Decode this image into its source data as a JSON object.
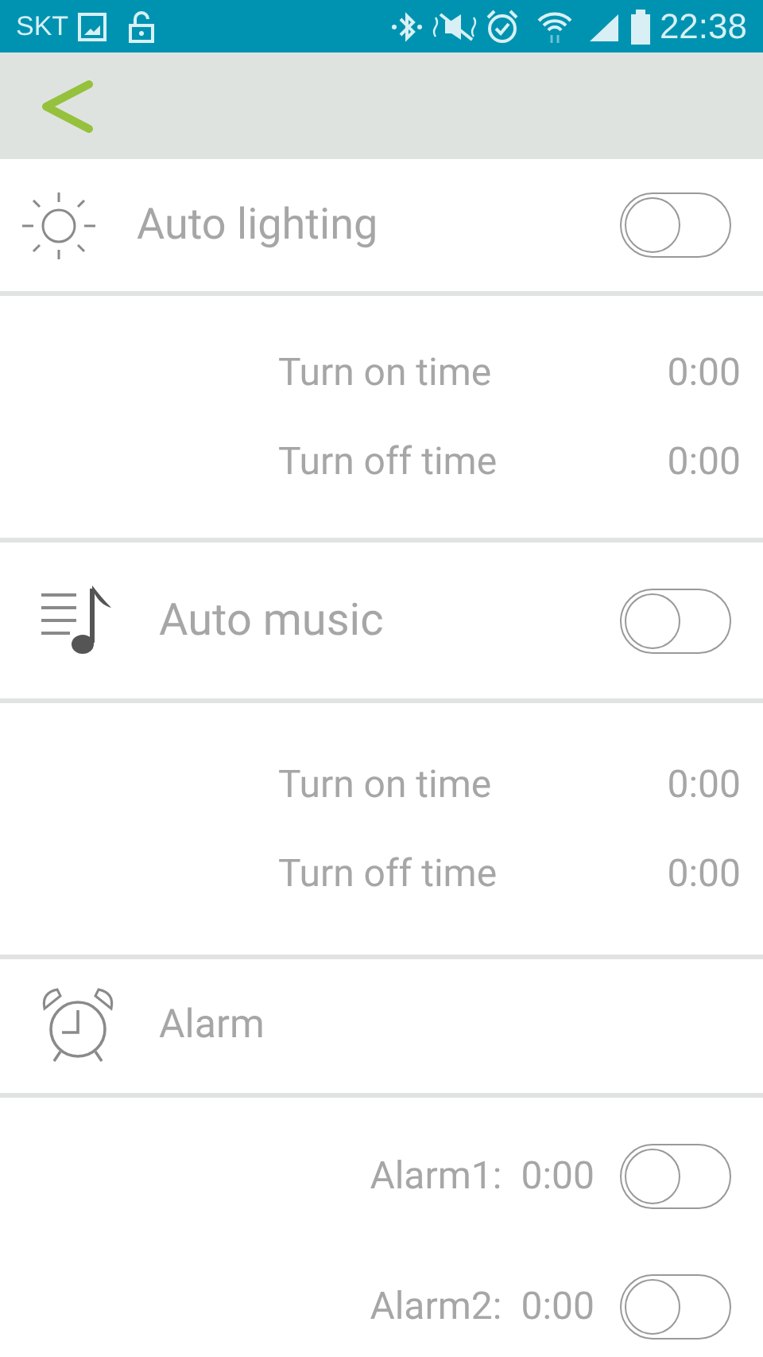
{
  "status_bar": {
    "carrier": "SKT",
    "time": "22:38"
  },
  "sections": [
    {
      "kind": "lighting",
      "title": "Auto lighting",
      "on": false,
      "rows": [
        {
          "label": "Turn on time",
          "value": "0:00"
        },
        {
          "label": "Turn off time",
          "value": "0:00"
        }
      ]
    },
    {
      "kind": "music",
      "title": "Auto music",
      "on": false,
      "rows": [
        {
          "label": "Turn on time",
          "value": "0:00"
        },
        {
          "label": "Turn off time",
          "value": "0:00"
        }
      ]
    },
    {
      "kind": "alarm",
      "title": "Alarm",
      "alarms": [
        {
          "label": "Alarm1:",
          "time": "0:00",
          "on": false
        },
        {
          "label": "Alarm2:",
          "time": "0:00",
          "on": false
        }
      ]
    }
  ]
}
